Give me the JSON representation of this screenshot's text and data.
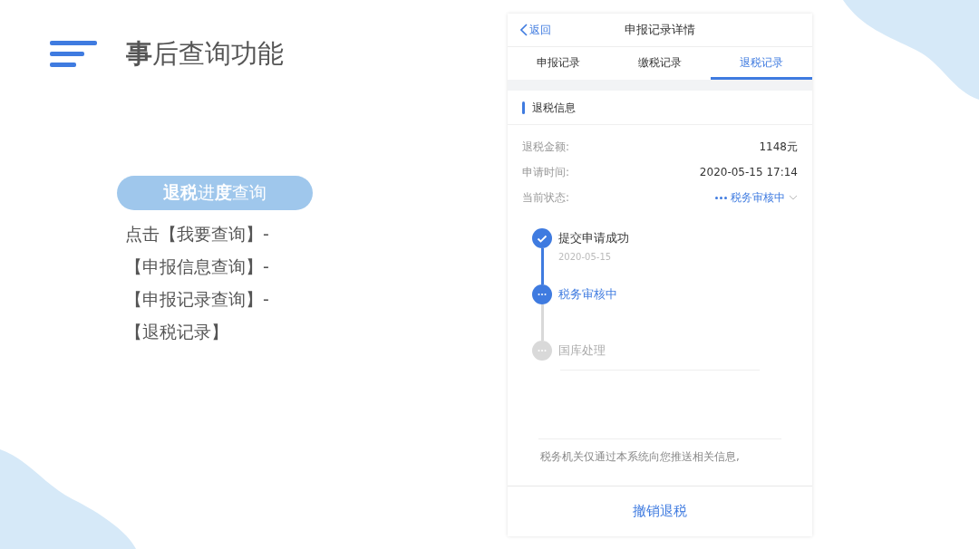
{
  "slide": {
    "title": "**事**后查询功能",
    "pill": "**退税**进**度**查询",
    "instructions": [
      "点击【我要查询】-",
      "【申报信息查询】-",
      "【申报记录查询】-",
      "【退税记录】"
    ]
  },
  "phone": {
    "back": "返回",
    "title": "申报记录详情",
    "tabs": [
      {
        "label": "申报记录",
        "selected": false
      },
      {
        "label": "缴税记录",
        "selected": false
      },
      {
        "label": "退税记录",
        "selected": true
      }
    ],
    "section_title": "退税信息",
    "fields": [
      {
        "label": "退税金额:",
        "value": "1148元",
        "kind": "plain"
      },
      {
        "label": "申请时间:",
        "value": "2020-05-15 17:14",
        "kind": "plain"
      },
      {
        "label": "当前状态:",
        "value": "税务审核中",
        "kind": "status"
      }
    ],
    "timeline": [
      {
        "title": "提交申请成功",
        "date": "2020-05-15",
        "kind": "done"
      },
      {
        "title": "税务审核中",
        "kind": "current"
      },
      {
        "title": "国库处理",
        "kind": "pending"
      }
    ],
    "notice": "税务机关仅通过本系统向您推送相关信息,",
    "action": "撤销退税"
  }
}
